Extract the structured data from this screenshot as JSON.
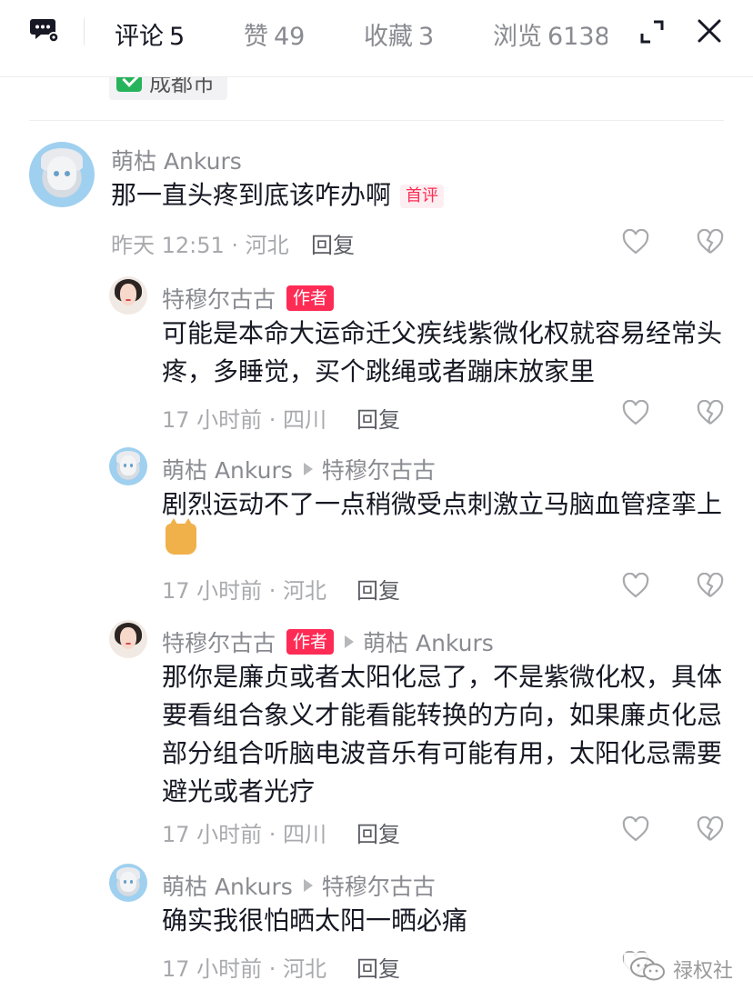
{
  "header": {
    "tabs": [
      {
        "label": "评论",
        "count": "5"
      },
      {
        "label": "赞",
        "count": "49"
      },
      {
        "label": "收藏",
        "count": "3"
      },
      {
        "label": "浏览",
        "count": "6138"
      }
    ]
  },
  "location_chip": "成都市",
  "comments": [
    {
      "user": "萌枯 Ankurs",
      "text": "那一直头疼到底该咋办啊",
      "badge": "首评",
      "time": "昨天 12:51 · 河北",
      "reply": "回复"
    },
    {
      "user": "特穆尔古古",
      "author_badge": "作者",
      "text": "可能是本命大运命迁父疾线紫微化权就容易经常头疼，多睡觉，买个跳绳或者蹦床放家里",
      "time": "17 小时前 · 四川",
      "reply": "回复"
    },
    {
      "user": "萌枯 Ankurs",
      "reply_to": "特穆尔古古",
      "text": "剧烈运动不了一点稍微受点刺激立马脑血管痉挛上",
      "time": "17 小时前 · 河北",
      "reply": "回复"
    },
    {
      "user": "特穆尔古古",
      "author_badge": "作者",
      "reply_to": "萌枯 Ankurs",
      "text": "那你是廉贞或者太阳化忌了，不是紫微化权，具体要看组合象义才能看能转换的方向，如果廉贞化忌部分组合听脑电波音乐有可能有用，太阳化忌需要避光或者光疗",
      "time": "17 小时前 · 四川",
      "reply": "回复"
    },
    {
      "user": "萌枯 Ankurs",
      "reply_to": "特穆尔古古",
      "text": "确实我很怕晒太阳一晒必痛",
      "time": "17 小时前 · 河北",
      "reply": "回复"
    }
  ],
  "watermark": "禄权社",
  "colors": {
    "accent": "#fe2c55",
    "muted": "#8a8b91"
  }
}
